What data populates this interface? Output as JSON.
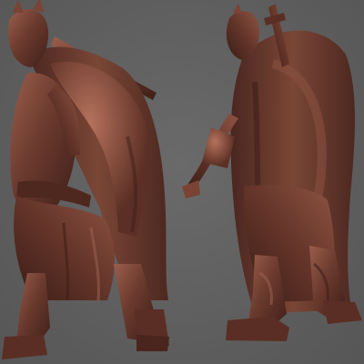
{
  "scene": {
    "background_color": "#5e5e5e",
    "clay_color": "#6b3a2e",
    "clay_highlight": "#9a5e4c",
    "clay_shadow": "#3e1f18",
    "views": [
      {
        "name": "front-three-quarter-view",
        "subject": "caped-warrior-figure"
      },
      {
        "name": "rear-three-quarter-view",
        "subject": "caped-warrior-figure"
      }
    ]
  }
}
